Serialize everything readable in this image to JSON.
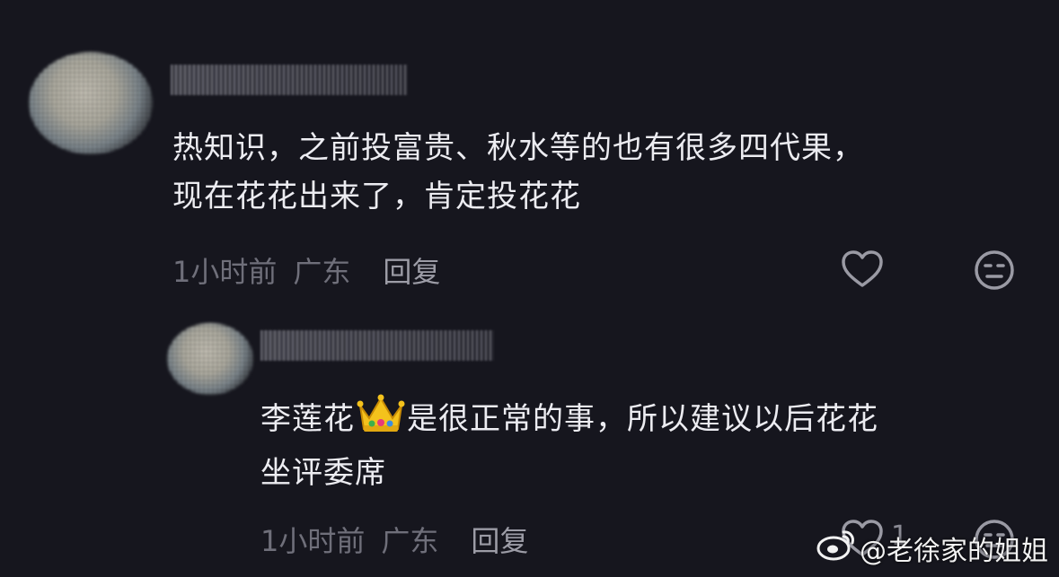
{
  "comments": [
    {
      "text_line1": "热知识，之前投富贵、秋水等的也有很多四代果，",
      "text_line2": "现在花花出来了，肯定投花花",
      "time": "1小时前",
      "location": "广东",
      "reply_label": "回复"
    },
    {
      "text_before_emoji": "李莲花",
      "emoji": "crown",
      "text_after_emoji": "是很正常的事，所以建议以后花花",
      "text_line2": "坐评委席",
      "time": "1小时前",
      "location": "广东",
      "reply_label": "回复",
      "like_count": "1"
    }
  ],
  "watermark": {
    "handle": "@老徐家的姐姐",
    "icon": "weibo-icon"
  },
  "colors": {
    "background": "#16161e",
    "text": "#ececf1",
    "meta": "#6f6f7a"
  }
}
